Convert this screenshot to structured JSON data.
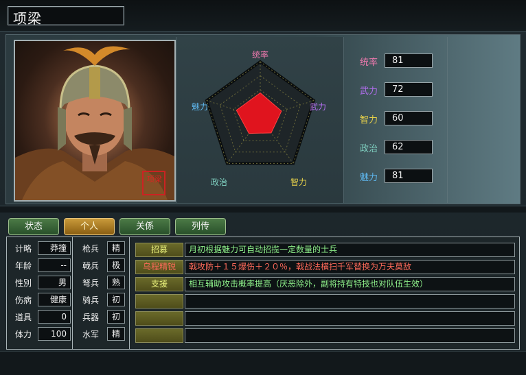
{
  "character": {
    "name": "项梁",
    "seal_text": "项梁"
  },
  "radar": {
    "labels": [
      {
        "key": "lead",
        "text": "统率",
        "color": "#f07ab0"
      },
      {
        "key": "war",
        "text": "武力",
        "color": "#b36ef0"
      },
      {
        "key": "intl",
        "text": "智力",
        "color": "#e8d24a"
      },
      {
        "key": "pol",
        "text": "政治",
        "color": "#7fd0c0"
      },
      {
        "key": "chr",
        "text": "魅力",
        "color": "#5fb8f0"
      }
    ],
    "max": 100
  },
  "stats": [
    {
      "label": "统率",
      "value": "81",
      "color": "#f07ab0"
    },
    {
      "label": "武力",
      "value": "72",
      "color": "#b36ef0"
    },
    {
      "label": "智力",
      "value": "60",
      "color": "#e8d24a"
    },
    {
      "label": "政治",
      "value": "62",
      "color": "#7fd0c0"
    },
    {
      "label": "魅力",
      "value": "81",
      "color": "#5fb8f0"
    }
  ],
  "tabs": [
    {
      "label": "状态",
      "active": false
    },
    {
      "label": "个人",
      "active": true
    },
    {
      "label": "关係",
      "active": false
    },
    {
      "label": "列传",
      "active": false
    }
  ],
  "attributes": [
    {
      "label": "计略",
      "value": "莽撞"
    },
    {
      "label": "年龄",
      "value": "--"
    },
    {
      "label": "性別",
      "value": "男"
    },
    {
      "label": "伤病",
      "value": "健康"
    },
    {
      "label": "道具",
      "value": "0"
    },
    {
      "label": "体力",
      "value": "100"
    }
  ],
  "troops": [
    {
      "label": "枪兵",
      "value": "精"
    },
    {
      "label": "戟兵",
      "value": "极"
    },
    {
      "label": "弩兵",
      "value": "熟"
    },
    {
      "label": "骑兵",
      "value": "初"
    },
    {
      "label": "兵器",
      "value": "初"
    },
    {
      "label": "水军",
      "value": "精"
    }
  ],
  "skills": [
    {
      "name": "招募",
      "name_color": "#e8f07a",
      "desc": "月初根据魅力可自动招揽一定数量的士兵",
      "desc_color": "#8ef08a"
    },
    {
      "name": "乌程精锐",
      "name_color": "#ff6a5a",
      "desc": "戟攻防＋１５爆伤＋２０％，戟战法横扫千军替换为万夫莫敌",
      "desc_color": "#ff6a5a"
    },
    {
      "name": "支援",
      "name_color": "#e8f07a",
      "desc": "相互辅助攻击概率提高（厌恶除外，副将持有特技也对队伍生效）",
      "desc_color": "#8ef08a"
    },
    {
      "name": "",
      "name_color": "#e8f07a",
      "desc": "",
      "desc_color": "#8ef08a"
    },
    {
      "name": "",
      "name_color": "#e8f07a",
      "desc": "",
      "desc_color": "#8ef08a"
    },
    {
      "name": "",
      "name_color": "#e8f07a",
      "desc": "",
      "desc_color": "#8ef08a"
    }
  ]
}
